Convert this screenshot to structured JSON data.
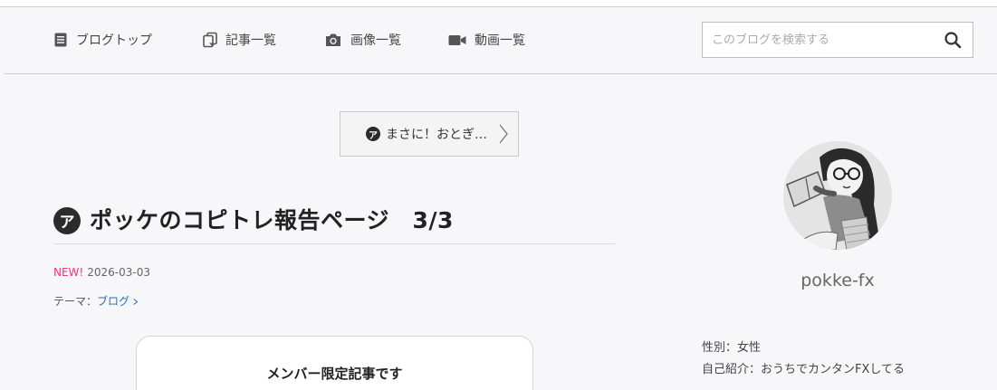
{
  "nav": {
    "items": [
      {
        "label": "ブログトップ",
        "icon": "blog-top-icon"
      },
      {
        "label": "記事一覧",
        "icon": "article-list-icon"
      },
      {
        "label": "画像一覧",
        "icon": "camera-icon"
      },
      {
        "label": "動画一覧",
        "icon": "video-icon"
      }
    ],
    "search_placeholder": "このブログを検索する"
  },
  "main": {
    "prev_label": "まさに！おとぎ…",
    "badge_char": "ア",
    "title": "ポッケのコピトレ報告ページ　3/3",
    "new_label": "NEW!",
    "date": "2026-03-03",
    "theme_prefix": "テーマ：",
    "theme_link": "ブログ",
    "member_notice": "メンバー限定記事です"
  },
  "sidebar": {
    "username": "pokke-fx",
    "gender": "性別：女性",
    "intro": "自己紹介：おうちでカンタンFXしてる"
  },
  "colors": {
    "background": "#f7f7f9",
    "accent_new": "#e8387f",
    "link": "#2b6cb0",
    "badge": "#2b2b2b"
  }
}
